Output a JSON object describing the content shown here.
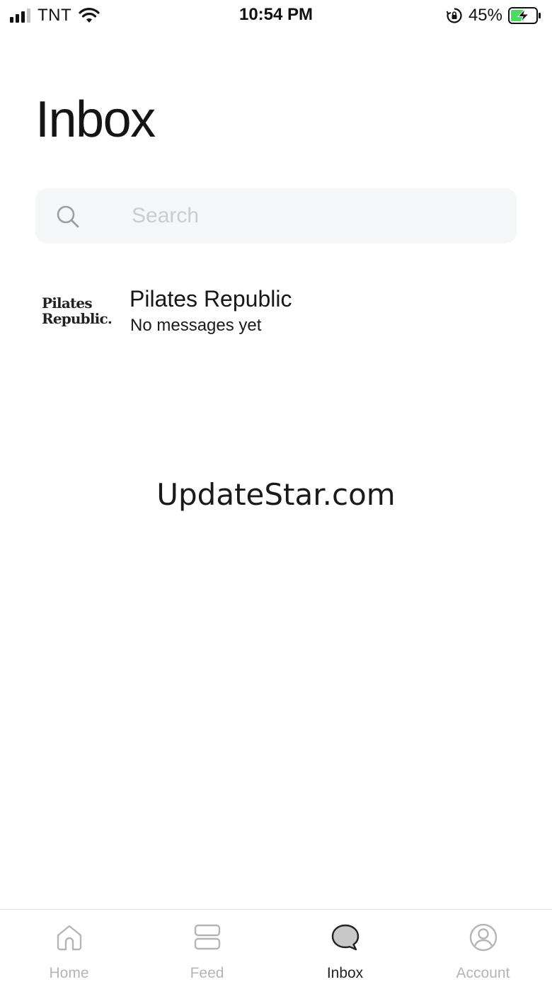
{
  "status_bar": {
    "carrier": "TNT",
    "time": "10:54 PM",
    "battery_percent": "45%",
    "icons": [
      "signal-icon",
      "wifi-icon",
      "orientation-lock-icon",
      "battery-charging-icon"
    ]
  },
  "header": {
    "title": "Inbox"
  },
  "search": {
    "placeholder": "Search",
    "value": ""
  },
  "conversations": [
    {
      "avatar_line1": "Pilates",
      "avatar_line2": "Republic.",
      "name": "Pilates Republic",
      "preview": "No messages yet"
    }
  ],
  "watermark": "UpdateStar.com",
  "tab_bar": {
    "tabs": [
      {
        "label": "Home",
        "icon": "home-icon",
        "active": false
      },
      {
        "label": "Feed",
        "icon": "feed-icon",
        "active": false
      },
      {
        "label": "Inbox",
        "icon": "chat-bubble-icon",
        "active": true
      },
      {
        "label": "Account",
        "icon": "account-icon",
        "active": false
      }
    ]
  },
  "colors": {
    "active_tab": "#222222",
    "inactive_tab": "#b5b5b5",
    "search_bg": "#f5f6f8",
    "battery_charge": "#4cd964"
  }
}
